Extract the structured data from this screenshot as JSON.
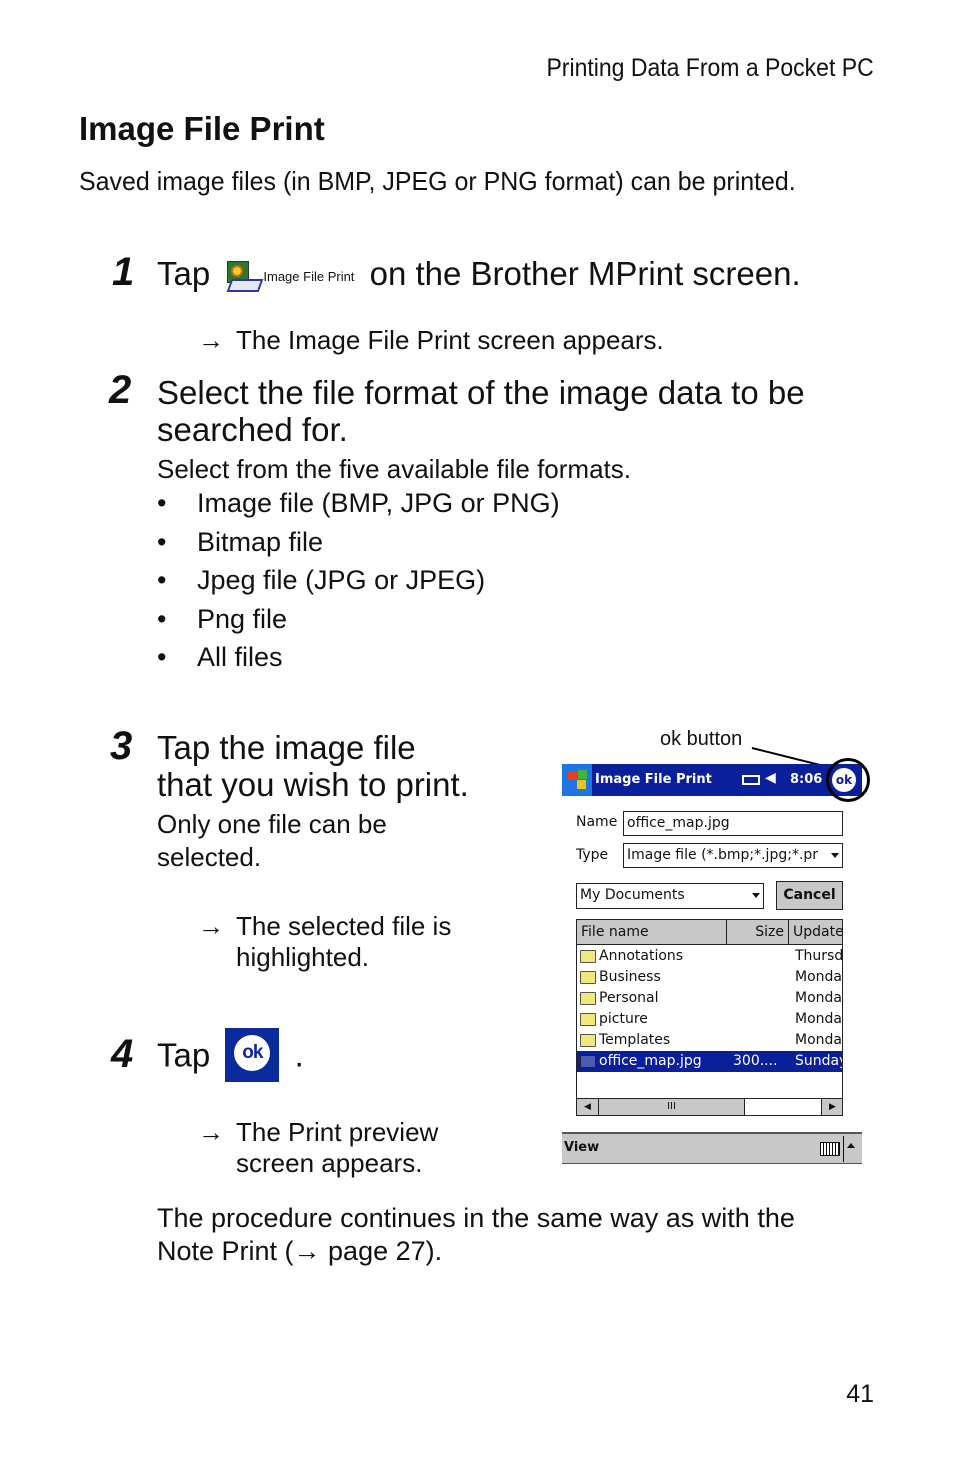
{
  "running_head": "Printing Data From a Pocket PC",
  "section_title": "Image File Print",
  "intro": "Saved image files (in BMP, JPEG or PNG format) can be printed.",
  "steps": [
    {
      "number": "1",
      "pre": "Tap",
      "icon_label": "Image File Print",
      "post": "on the Brother MPrint screen.",
      "result": "The Image File Print screen appears."
    },
    {
      "number": "2",
      "heading_line1": "Select the file format of the image data to be",
      "heading_line2": "searched for.",
      "body": "Select from the five available file formats.",
      "bullets": [
        "Image file (BMP, JPG or PNG)",
        "Bitmap file",
        "Jpeg file (JPG or JPEG)",
        "Png file",
        "All files"
      ]
    },
    {
      "number": "3",
      "heading_line1": "Tap the image file",
      "heading_line2": "that you wish to print.",
      "body_line1": "Only one file can be",
      "body_line2": "selected.",
      "result_line1": "The selected file is",
      "result_line2": "highlighted."
    },
    {
      "number": "4",
      "pre": "Tap",
      "icon_label": "ok",
      "post": ".",
      "result_line1": "The Print preview",
      "result_line2": "screen appears."
    }
  ],
  "arrow": "→",
  "closing_line1": "The procedure continues in the same way as with the",
  "closing_line2": "Note Print (→ page 27).",
  "page_number": "41",
  "screenshot": {
    "callout": "ok button",
    "title": "Image File Print",
    "time": "8:06",
    "ok_label": "ok",
    "name_label": "Name",
    "name_value": "office_map.jpg",
    "type_label": "Type",
    "type_value": "Image file (*.bmp;*.jpg;*.pr",
    "folder_value": "My Documents",
    "cancel_label": "Cancel",
    "columns": [
      "File name",
      "Size",
      "Update"
    ],
    "rows": [
      {
        "name": "Annotations",
        "size": "",
        "date": "Thursd",
        "type": "folder"
      },
      {
        "name": "Business",
        "size": "",
        "date": "Monda",
        "type": "folder"
      },
      {
        "name": "Personal",
        "size": "",
        "date": "Monda",
        "type": "folder"
      },
      {
        "name": "picture",
        "size": "",
        "date": "Monda",
        "type": "folder"
      },
      {
        "name": "Templates",
        "size": "",
        "date": "Monda",
        "type": "folder"
      },
      {
        "name": "office_map.jpg",
        "size": "300....",
        "date": "Sunday",
        "type": "file",
        "selected": true
      }
    ],
    "scroll_thumb": "III",
    "menu_view": "View",
    "colors": {
      "titlebar": "#0a1f9a",
      "chrome": "#c8c8c8",
      "selection": "#0a1f9a"
    }
  }
}
